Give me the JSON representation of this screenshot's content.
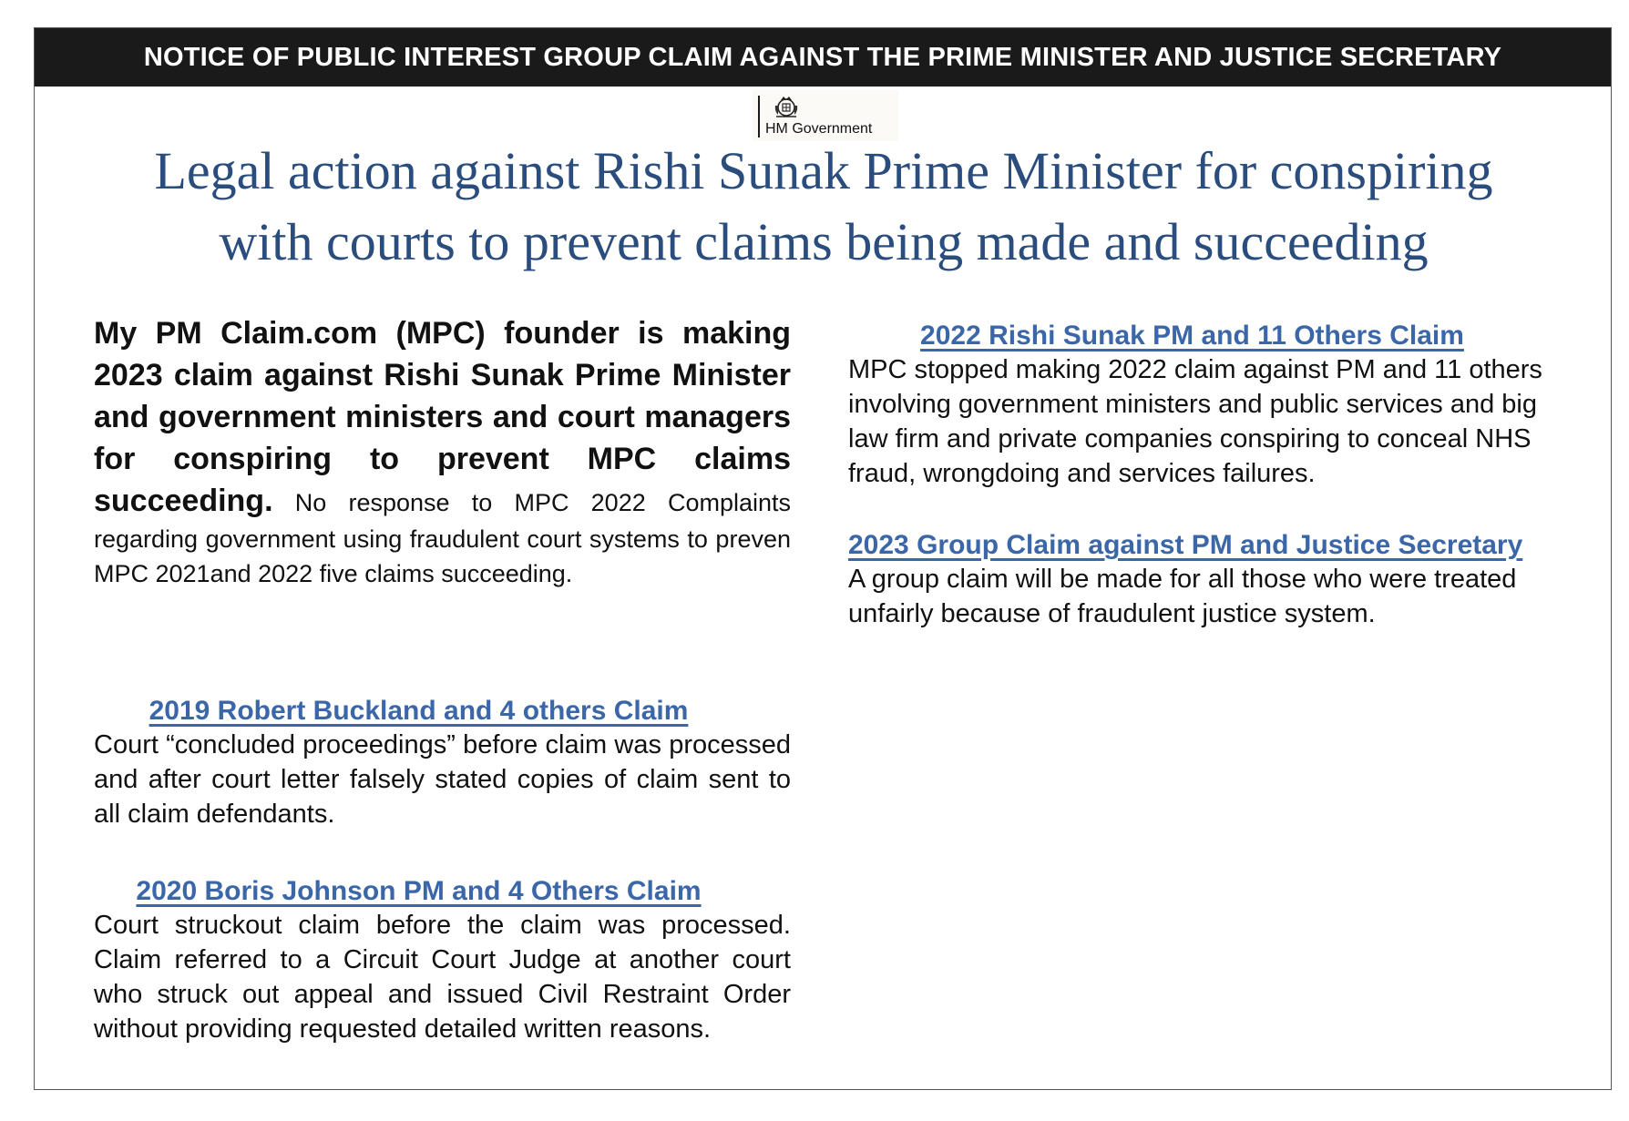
{
  "banner": {
    "text": "NOTICE OF PUBLIC INTEREST GROUP CLAIM AGAINST THE PRIME MINISTER AND JUSTICE SECRETARY"
  },
  "logo": {
    "text": "HM Government",
    "icon": "royal-crest-icon"
  },
  "headline": {
    "line1": "Legal action against Rishi Sunak Prime Minister for conspiring",
    "line2": "with courts to prevent claims being made and succeeding"
  },
  "intro": {
    "lead": "My PM Claim.com (MPC) founder is making 2023 claim against Rishi Sunak Prime Minister and government ministers and court managers for conspiring to prevent MPC claims succeeding.",
    "body": " No response to MPC 2022 Complaints regarding government using fraudulent court systems to preven MPC 2021and 2022 five claims succeeding."
  },
  "claims": [
    {
      "title": "2019 Robert Buckland and 4 others Claim",
      "body": "Court “concluded proceedings” before claim was processed and after court letter falsely stated copies of claim sent to all claim defendants."
    },
    {
      "title": "2020 Boris Johnson PM and 4 Others Claim",
      "body": "Court struckout claim before the claim was processed. Claim referred to a Circuit Court Judge at another  court who struck out appeal and issued Civil Restraint Order without providing requested detailed written reasons."
    },
    {
      "title": "2022 Rishi Sunak PM and 11 Others Claim",
      "body": "MPC stopped making 2022 claim against PM and 11 others involving government ministers and public services and big law firm and private companies conspiring to conceal NHS fraud, wrongdoing and services failures."
    },
    {
      "title": "2023 Group Claim against  PM and Justice Secretary",
      "body": "A group claim will be made for all those who were treated unfairly because of fraudulent justice system."
    }
  ],
  "colors": {
    "banner_bg": "#1a1a1a",
    "headline": "#2a4d7e",
    "claim_title": "#3b67a8"
  }
}
